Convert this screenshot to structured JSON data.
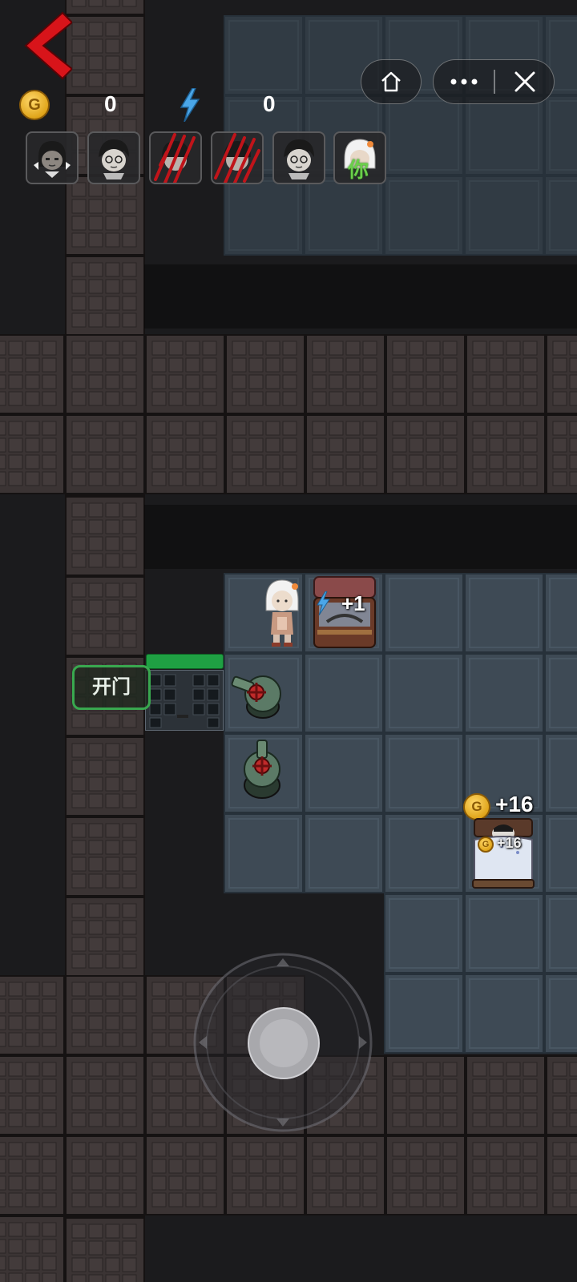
{
  "hud": {
    "coins": "0",
    "energy": "0",
    "coin_symbol": "G"
  },
  "characters": [
    {
      "name": "girl-with-bows",
      "state": "normal"
    },
    {
      "name": "boy-glasses",
      "state": "normal"
    },
    {
      "name": "girl-scratched",
      "state": "attacked"
    },
    {
      "name": "boy-scratched",
      "state": "attacked"
    },
    {
      "name": "boy-glasses-2",
      "state": "normal"
    },
    {
      "name": "you",
      "state": "self",
      "label": "你"
    }
  ],
  "map": {
    "door_button": "开门",
    "door_health_fraction": 1.0,
    "chest_bonus": "+1",
    "bed_bonus": "+16",
    "bed_bonus_small": "+16",
    "bed_coin_symbol": "G"
  },
  "colors": {
    "back_arrow": "#d8141a",
    "door_green": "#39a84f",
    "claw_red": "#c0141a"
  }
}
